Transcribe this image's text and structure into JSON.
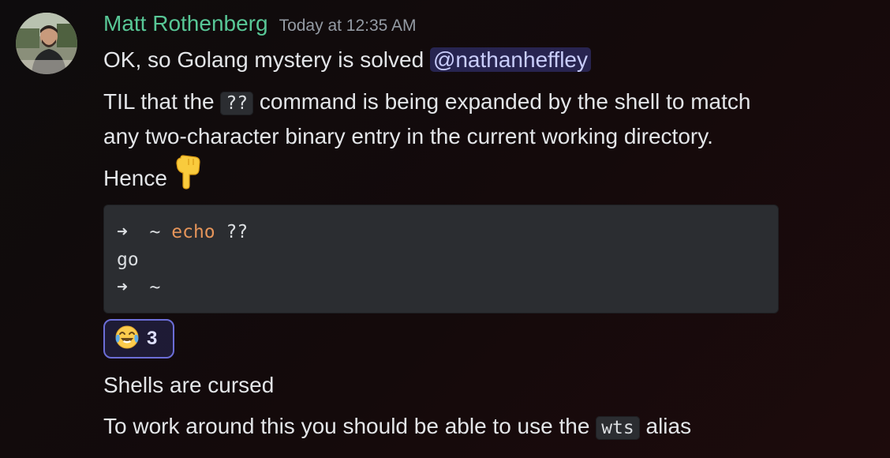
{
  "message": {
    "author": "Matt Rothenberg",
    "timestamp": "Today at 12:35 AM",
    "line1_text": "OK, so Golang mystery is solved ",
    "mention": "@nathanheffley",
    "line2_pre": "TIL that the ",
    "line2_code": "??",
    "line2_post": " command is being expanded by the shell to match",
    "line3": "any two-character binary entry in the current working directory.",
    "line4": "Hence",
    "pointing_emoji_icon": "backhand-index-pointing-down-icon"
  },
  "code_block": {
    "line1_prompt": "➜  ~ ",
    "line1_cmd": "echo",
    "line1_args": " ??",
    "line2": "go",
    "line3": "➜  ~"
  },
  "reaction": {
    "icon": "tears-of-joy-emoji-icon",
    "count": "3"
  },
  "follow_ups": {
    "line1": "Shells are cursed",
    "line2_pre": "To work around this you should be able to use the ",
    "line2_code": "wts",
    "line2_post": " alias"
  },
  "colors": {
    "username": "#58c796",
    "mention_bg": "#3b3f6f",
    "code_bg": "#2b2d31",
    "command": "#e6955a",
    "reaction_border": "#6b6dd6"
  }
}
